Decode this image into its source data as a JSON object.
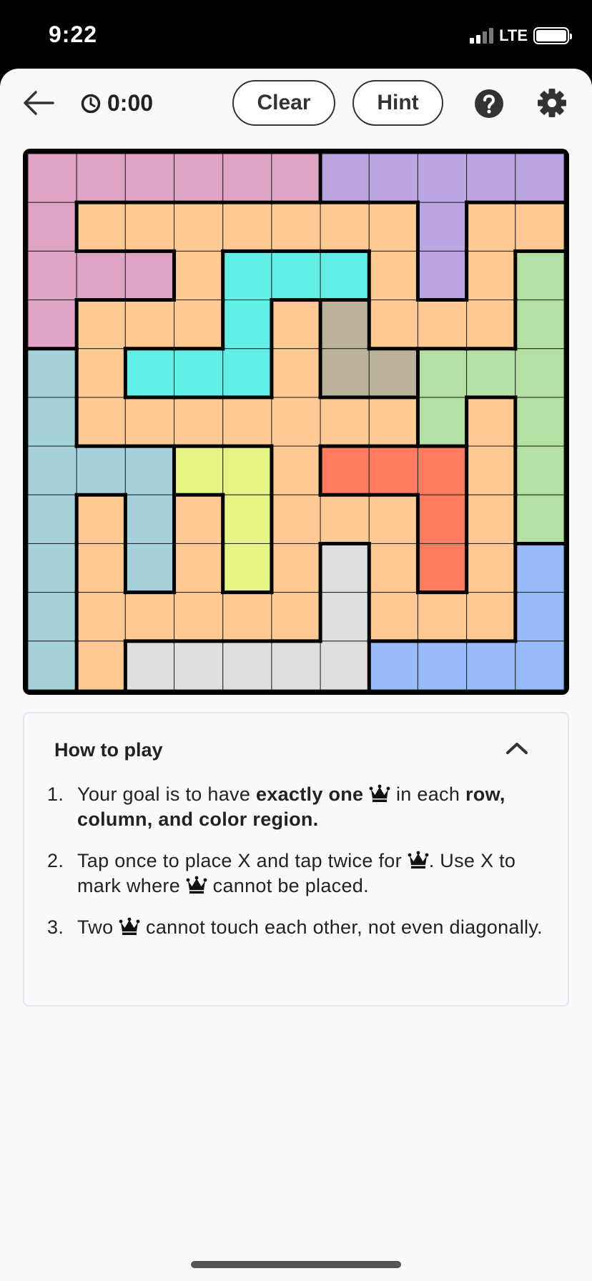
{
  "status_bar": {
    "time": "9:22",
    "network": "LTE",
    "signal_bars": 2,
    "battery_level": 1.0
  },
  "toolbar": {
    "timer": "0:00",
    "clear_label": "Clear",
    "hint_label": "Hint"
  },
  "board": {
    "size": 11,
    "colors": {
      "A": "#dfa3c4",
      "B": "#bba5e2",
      "C": "#fec993",
      "D": "#62eee7",
      "E": "#b4e0a3",
      "F": "#bab29b",
      "G": "#a5d2da",
      "H": "#e5f485",
      "I": "#fe7b5e",
      "J": "#dfdfdf",
      "K": "#98bbfd"
    },
    "rows": [
      "AAAAAABBBBB",
      "ACCCCCCCBCC",
      "AAACDDDCBCE",
      "ACCCDCFCCCE",
      "GCDDDCFFEEE",
      "GCCCCCCCECE",
      "GGGHHCIIICE",
      "GCGCHCCCICE",
      "GCGCHCJCICK",
      "GCCCCCJCCCK",
      "GCJJJJJKKKK"
    ]
  },
  "how_to_play": {
    "title": "How to play",
    "items": [
      {
        "n": "1.",
        "parts": [
          "Your goal is to have ",
          "exactly one",
          " in each ",
          "row, column, and color region."
        ]
      },
      {
        "n": "2.",
        "parts": [
          "Tap once to place X and tap twice for ",
          ". Use X to mark where ",
          " cannot be placed."
        ]
      },
      {
        "n": "3.",
        "parts": [
          "Two ",
          " cannot touch each other, not even diagonally."
        ]
      }
    ]
  }
}
